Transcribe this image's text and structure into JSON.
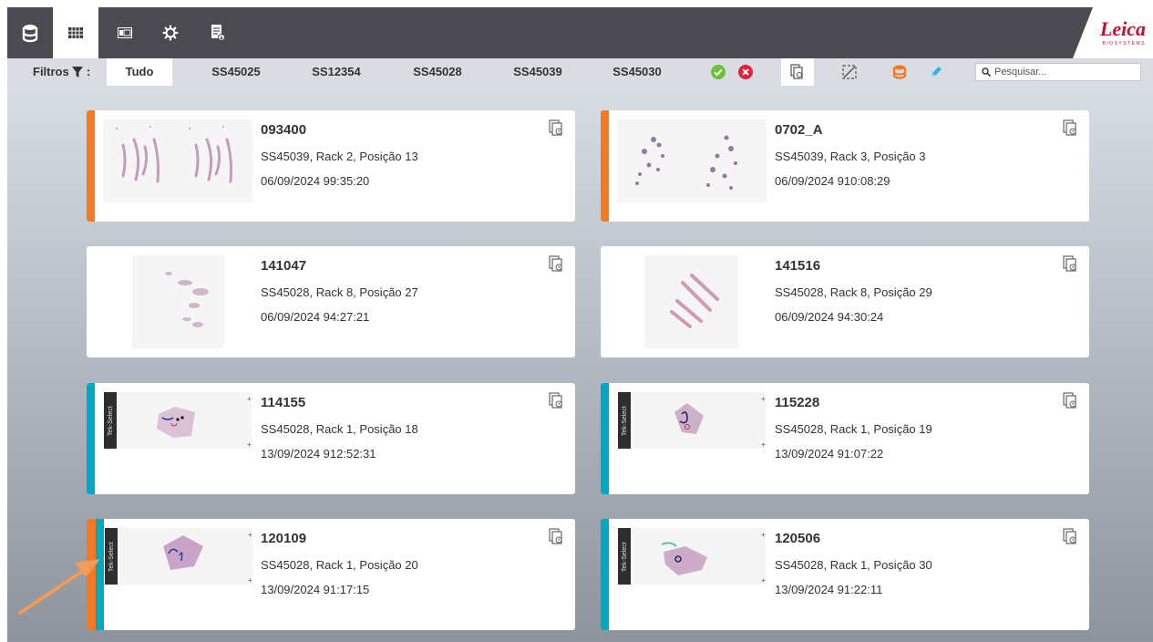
{
  "toolbar": {
    "buttons": [
      {
        "name": "specimen-icon"
      },
      {
        "name": "grid-view-icon",
        "active": true
      },
      {
        "name": "slide-view-icon"
      },
      {
        "name": "settings-icon"
      },
      {
        "name": "export-report-icon"
      }
    ],
    "logo": {
      "word": "Leica",
      "sub": "BIOSYSTEMS"
    }
  },
  "filters": {
    "label": "Filtros",
    "separator": ":",
    "tabs": [
      "Tudo",
      "SS45025",
      "SS12354",
      "SS45028",
      "SS45039",
      "SS45030"
    ],
    "status_icons": [
      "check-icon",
      "error-icon",
      "copy-status-icon",
      "no-capture-icon",
      "specimen-orange-icon",
      "edit-pen-icon"
    ],
    "search_placeholder": "Pesquisar..."
  },
  "colors": {
    "orange": "#f47920",
    "teal": "#00a8c3",
    "toolbar": "#4a4a50",
    "filterbar": "#d9dde2"
  },
  "cards": [
    {
      "name": "093400",
      "location": "SS45039, Rack 2, Posição 13",
      "timestamp": "06/09/2024 99:35:20",
      "stripes": [
        "orange"
      ]
    },
    {
      "name": "0702_A",
      "location": "SS45039, Rack 3, Posição 3",
      "timestamp": "06/09/2024 910:08:29",
      "stripes": [
        "orange"
      ]
    },
    {
      "name": "141047",
      "location": "SS45028, Rack 8, Posição 27",
      "timestamp": "06/09/2024 94:27:21",
      "stripes": []
    },
    {
      "name": "141516",
      "location": "SS45028, Rack 8, Posição 29",
      "timestamp": "06/09/2024 94:30:24",
      "stripes": []
    },
    {
      "name": "114155",
      "location": "SS45028, Rack 1, Posição 18",
      "timestamp": "13/09/2024 912:52:31",
      "stripes": [
        "teal"
      ]
    },
    {
      "name": "115228",
      "location": "SS45028, Rack 1, Posição 19",
      "timestamp": "13/09/2024 91:07:22",
      "stripes": [
        "teal"
      ]
    },
    {
      "name": "120109",
      "location": "SS45028, Rack 1, Posição 20",
      "timestamp": "13/09/2024 91:17:15",
      "stripes": [
        "orange",
        "teal"
      ]
    },
    {
      "name": "120506",
      "location": "SS45028, Rack 1, Posição 30",
      "timestamp": "13/09/2024 91:22:11",
      "stripes": [
        "teal"
      ]
    }
  ],
  "slide_label": {
    "text": "Tek-Select"
  }
}
